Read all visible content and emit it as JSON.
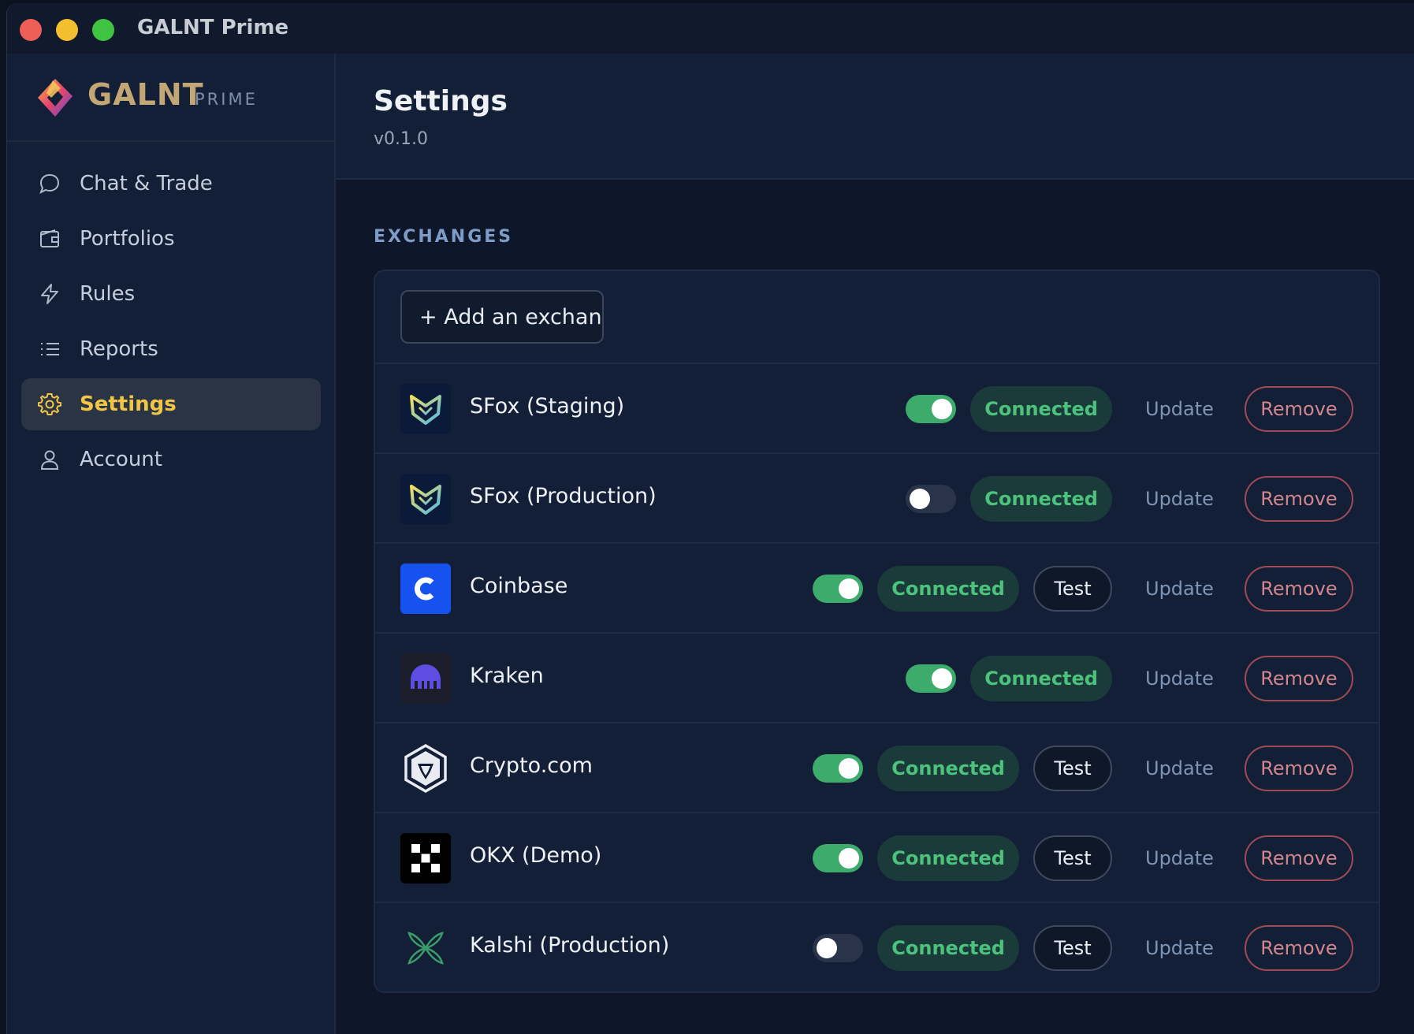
{
  "window": {
    "title": "GALNT Prime"
  },
  "brand": {
    "name": "GALNT",
    "sub": "PRIME"
  },
  "sidebar": {
    "items": [
      {
        "label": "Chat & Trade",
        "icon": "chat-bubble-icon",
        "active": false
      },
      {
        "label": "Portfolios",
        "icon": "wallet-icon",
        "active": false
      },
      {
        "label": "Rules",
        "icon": "lightning-icon",
        "active": false
      },
      {
        "label": "Reports",
        "icon": "list-icon",
        "active": false
      },
      {
        "label": "Settings",
        "icon": "gear-icon",
        "active": true
      },
      {
        "label": "Account",
        "icon": "user-icon",
        "active": false
      }
    ]
  },
  "header": {
    "title": "Settings",
    "version": "v0.1.0"
  },
  "exchanges": {
    "section_title": "EXCHANGES",
    "add_label": "+ Add an exchange",
    "items": [
      {
        "name": "SFox (Staging)",
        "logo": "sfox-logo-icon",
        "enabled": true,
        "status": "Connected",
        "test_label": "",
        "update_label": "Update",
        "remove_label": "Remove"
      },
      {
        "name": "SFox (Production)",
        "logo": "sfox-logo-icon",
        "enabled": false,
        "status": "Connected",
        "test_label": "",
        "update_label": "Update",
        "remove_label": "Remove"
      },
      {
        "name": "Coinbase",
        "logo": "coinbase-logo-icon",
        "enabled": true,
        "status": "Connected",
        "test_label": "Test",
        "update_label": "Update",
        "remove_label": "Remove"
      },
      {
        "name": "Kraken",
        "logo": "kraken-logo-icon",
        "enabled": true,
        "status": "Connected",
        "test_label": "",
        "update_label": "Update",
        "remove_label": "Remove"
      },
      {
        "name": "Crypto.com",
        "logo": "cryptocom-logo-icon",
        "enabled": true,
        "status": "Connected",
        "test_label": "Test",
        "update_label": "Update",
        "remove_label": "Remove"
      },
      {
        "name": "OKX (Demo)",
        "logo": "okx-logo-icon",
        "enabled": true,
        "status": "Connected",
        "test_label": "Test",
        "update_label": "Update",
        "remove_label": "Remove"
      },
      {
        "name": "Kalshi (Production)",
        "logo": "kalshi-logo-icon",
        "enabled": false,
        "status": "Connected",
        "test_label": "Test",
        "update_label": "Update",
        "remove_label": "Remove"
      }
    ]
  },
  "colors": {
    "accent": "#f1c644",
    "success": "#4cc27c",
    "danger": "#d0868c",
    "toggle_on": "#3dab6b"
  }
}
